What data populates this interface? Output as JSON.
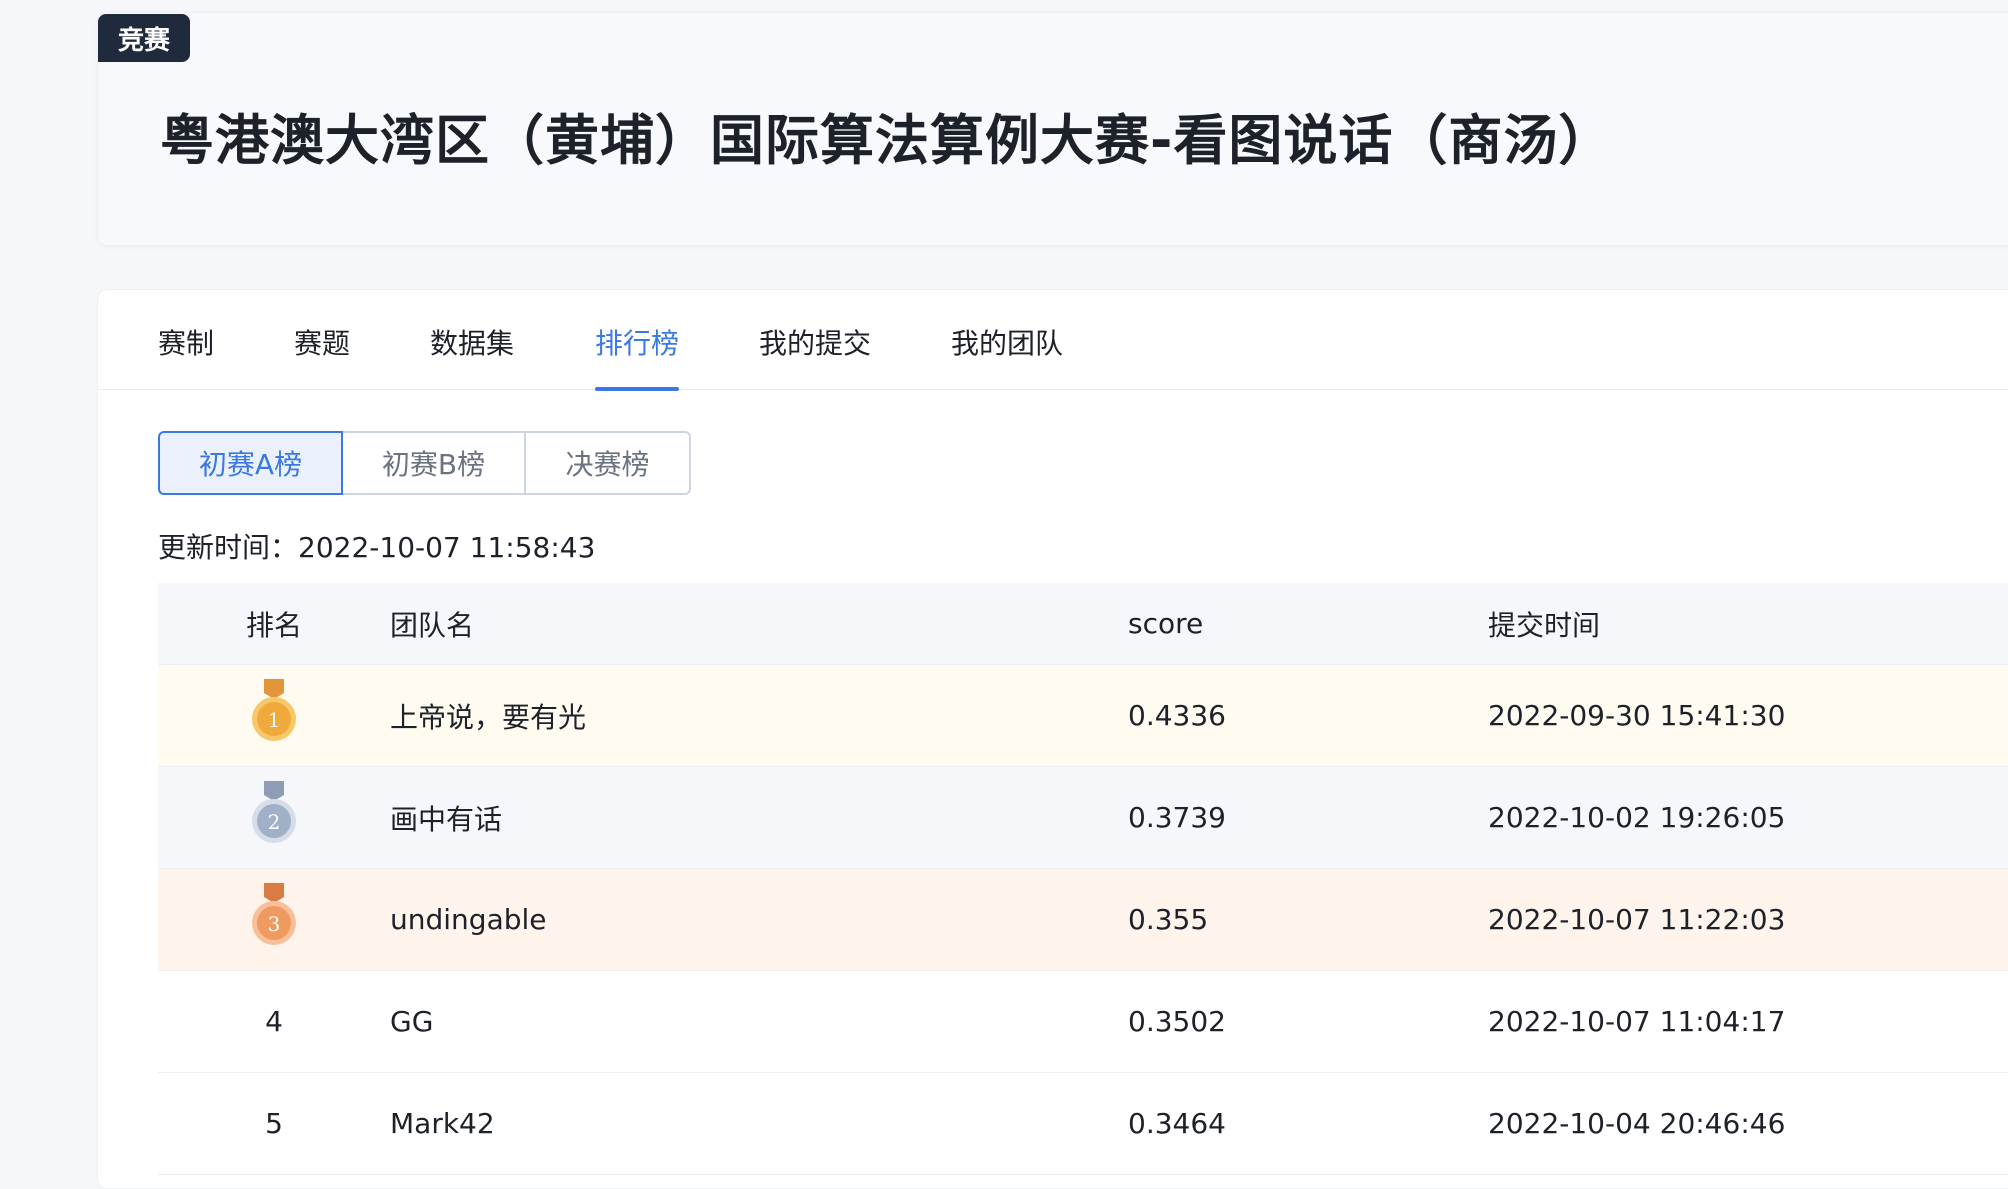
{
  "header": {
    "badge": "竞赛",
    "title": "粤港澳大湾区（黄埔）国际算法算例大赛-看图说话（商汤）"
  },
  "tabs": [
    {
      "label": "赛制",
      "active": false
    },
    {
      "label": "赛题",
      "active": false
    },
    {
      "label": "数据集",
      "active": false
    },
    {
      "label": "排行榜",
      "active": true
    },
    {
      "label": "我的提交",
      "active": false
    },
    {
      "label": "我的团队",
      "active": false
    }
  ],
  "boards": [
    {
      "label": "初赛A榜",
      "active": true
    },
    {
      "label": "初赛B榜",
      "active": false
    },
    {
      "label": "决赛榜",
      "active": false
    }
  ],
  "update": {
    "label": "更新时间：",
    "value": "2022-10-07 11:58:43"
  },
  "table": {
    "columns": [
      "排名",
      "团队名",
      "score",
      "提交时间"
    ],
    "rows": [
      {
        "rank": "1",
        "medal": "gold",
        "team": "上帝说，要有光",
        "score": "0.4336",
        "time": "2022-09-30 15:41:30"
      },
      {
        "rank": "2",
        "medal": "silver",
        "team": "画中有话",
        "score": "0.3739",
        "time": "2022-10-02 19:26:05"
      },
      {
        "rank": "3",
        "medal": "bronze",
        "team": "undingable",
        "score": "0.355",
        "time": "2022-10-07 11:22:03"
      },
      {
        "rank": "4",
        "medal": "",
        "team": "GG",
        "score": "0.3502",
        "time": "2022-10-07 11:04:17"
      },
      {
        "rank": "5",
        "medal": "",
        "team": "Mark42",
        "score": "0.3464",
        "time": "2022-10-04 20:46:46"
      }
    ]
  },
  "colors": {
    "accent": "#3a78e2",
    "gold": "#f0a93b",
    "silver": "#9fb0c8",
    "bronze": "#ef9a5e"
  }
}
